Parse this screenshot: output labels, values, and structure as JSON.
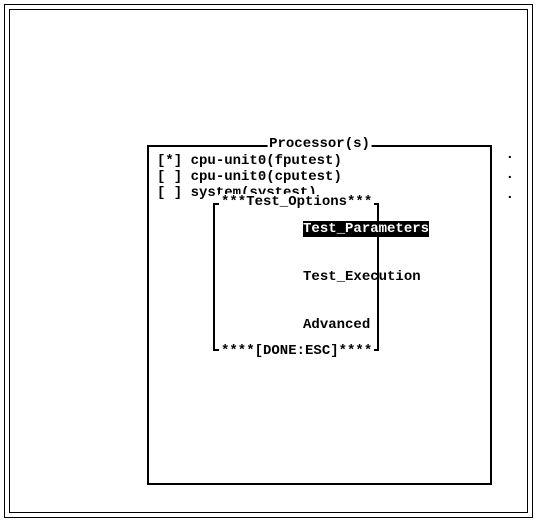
{
  "panel": {
    "title": "Processor(s)",
    "items": [
      {
        "checked": "[*]",
        "label": " cpu-unit0(fputest)"
      },
      {
        "checked": "[ ]",
        "label": " cpu-unit0(cputest)"
      },
      {
        "checked": "[ ]",
        "label": " system(systest)"
      }
    ]
  },
  "submenu": {
    "title": "***Test_Options***",
    "items": [
      {
        "label": "Test_Parameters",
        "selected": true
      },
      {
        "label": "Test_Execution",
        "selected": false
      },
      {
        "label": "Advanced",
        "selected": false
      }
    ],
    "footer": "****[DONE:ESC]****"
  },
  "dots": {
    "d1": ".",
    "d2": ".",
    "d3": "."
  }
}
